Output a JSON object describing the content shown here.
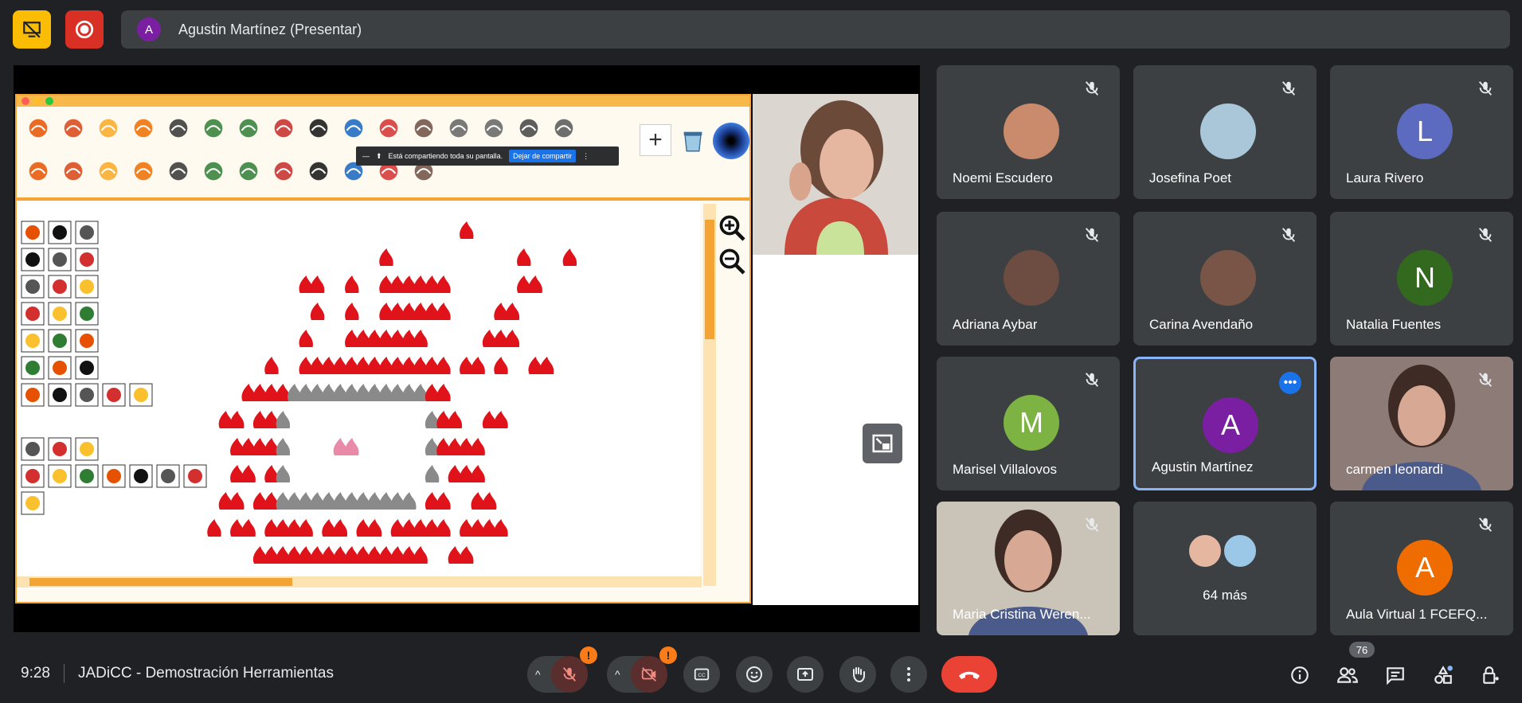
{
  "presenter": {
    "initial": "A",
    "label": "Agustin Martínez (Presentar)"
  },
  "share_bar": {
    "message": "Está compartiendo toda su pantalla.",
    "stop_label": "Dejar de compartir"
  },
  "participants": [
    {
      "name": "Noemi Escudero",
      "type": "photo",
      "color": "#c98b6b",
      "muted": true
    },
    {
      "name": "Josefina Poet",
      "type": "photo",
      "color": "#a9c7d8",
      "muted": true
    },
    {
      "name": "Laura Rivero",
      "type": "initial",
      "initial": "L",
      "color": "#5c6bc0",
      "muted": true
    },
    {
      "name": "Adriana Aybar",
      "type": "photo",
      "color": "#6d4c41",
      "muted": true
    },
    {
      "name": "Carina Avendaño",
      "type": "photo",
      "color": "#795548",
      "muted": true
    },
    {
      "name": "Natalia Fuentes",
      "type": "initial",
      "initial": "N",
      "color": "#33691e",
      "muted": true
    },
    {
      "name": "Marisel Villalovos",
      "type": "initial",
      "initial": "M",
      "color": "#7cb342",
      "muted": true
    },
    {
      "name": "Agustin Martínez",
      "type": "initial",
      "initial": "A",
      "color": "#7b1fa2",
      "muted": false,
      "active": true
    },
    {
      "name": "carmen leonardi",
      "type": "video",
      "color": "#8d7b77",
      "muted": true
    },
    {
      "name": "Maria Cristina Weren...",
      "type": "video",
      "color": "#c9c3b8",
      "muted": true
    },
    {
      "name": "64 más",
      "type": "more",
      "color": "#3c4043",
      "muted": false
    },
    {
      "name": "Aula Virtual 1 FCEFQ...",
      "type": "initial",
      "initial": "A",
      "color": "#ef6c00",
      "muted": true
    }
  ],
  "bottom": {
    "time": "9:28",
    "meeting_title": "JADiCC - Demostración Herramientas",
    "participant_count": "76",
    "warning_badge": "!"
  },
  "icons": {
    "top_left": "presentation-off-icon",
    "top_record": "record-icon",
    "toolbar_tools": [
      "pointing-hand",
      "hand",
      "clown",
      "jester",
      "eyes",
      "pull",
      "push",
      "no-sign",
      "runner",
      "stick-figure",
      "explosion",
      "hourglass",
      "keys",
      "keys2",
      "box",
      "stairs"
    ],
    "toolbar_tools_row2": [
      "shape",
      "face",
      "brush",
      "scribble",
      "loops",
      "fire",
      "skull",
      "sparkle",
      "leaf",
      "drop",
      "person",
      "leaf2"
    ]
  }
}
